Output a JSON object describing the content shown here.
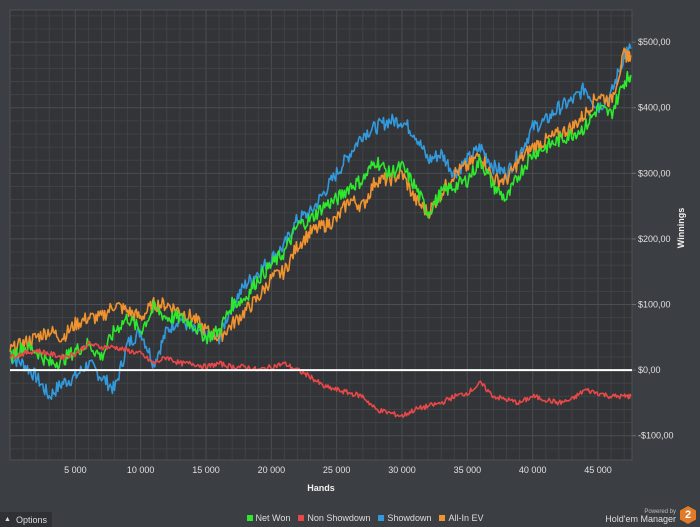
{
  "chart_data": {
    "type": "line",
    "title": "",
    "xlabel": "Hands",
    "ylabel": "Winnings",
    "xlim": [
      0,
      47600
    ],
    "ylim": [
      -137,
      549
    ],
    "xticks": [
      5000,
      10000,
      15000,
      20000,
      25000,
      30000,
      35000,
      40000,
      45000
    ],
    "xtick_labels": [
      "5 000",
      "10 000",
      "15 000",
      "20 000",
      "25 000",
      "30 000",
      "35 000",
      "40 000",
      "45 000"
    ],
    "yticks": [
      -100,
      0,
      100,
      200,
      300,
      400,
      500
    ],
    "ytick_labels": [
      "-$100,00",
      "$0,00",
      "$100,00",
      "$200,00",
      "$300,00",
      "$400,00",
      "$500,00"
    ],
    "grid": true,
    "legend_position": "bottom-center",
    "x": [
      0,
      1000,
      2000,
      3000,
      4000,
      5000,
      6000,
      7000,
      8000,
      9000,
      10000,
      11000,
      12000,
      13000,
      14000,
      15000,
      16000,
      17000,
      18000,
      19000,
      20000,
      21000,
      22000,
      23000,
      24000,
      25000,
      26000,
      27000,
      28000,
      29000,
      30000,
      31000,
      32000,
      33000,
      34000,
      35000,
      36000,
      37000,
      38000,
      39000,
      40000,
      41000,
      42000,
      43000,
      44000,
      45000,
      46000,
      47000,
      47500
    ],
    "series": [
      {
        "name": "Net Won",
        "color": "#2ee82e",
        "values": [
          20,
          35,
          30,
          10,
          15,
          30,
          40,
          20,
          60,
          80,
          60,
          95,
          80,
          80,
          70,
          50,
          60,
          100,
          110,
          140,
          160,
          180,
          220,
          230,
          250,
          260,
          280,
          290,
          320,
          300,
          310,
          280,
          240,
          270,
          280,
          290,
          320,
          280,
          260,
          300,
          330,
          340,
          350,
          360,
          370,
          400,
          390,
          440,
          450
        ]
      },
      {
        "name": "Non Showdown",
        "color": "#e84848",
        "values": [
          20,
          25,
          30,
          25,
          20,
          25,
          40,
          35,
          35,
          30,
          25,
          10,
          20,
          10,
          10,
          5,
          10,
          5,
          5,
          0,
          5,
          10,
          0,
          -10,
          -25,
          -30,
          -35,
          -40,
          -60,
          -65,
          -70,
          -60,
          -55,
          -50,
          -40,
          -35,
          -20,
          -40,
          -45,
          -50,
          -40,
          -45,
          -50,
          -45,
          -30,
          -35,
          -40,
          -40,
          -40
        ]
      },
      {
        "name": "Showdown",
        "color": "#3399dd",
        "values": [
          20,
          10,
          -10,
          -40,
          -20,
          -10,
          10,
          -10,
          -30,
          40,
          60,
          10,
          60,
          80,
          60,
          50,
          50,
          100,
          130,
          150,
          170,
          190,
          230,
          240,
          270,
          300,
          330,
          360,
          370,
          380,
          380,
          360,
          320,
          330,
          300,
          320,
          340,
          310,
          300,
          330,
          370,
          380,
          400,
          410,
          430,
          400,
          420,
          480,
          490
        ]
      },
      {
        "name": "All-In EV",
        "color": "#f0922e",
        "values": [
          30,
          40,
          50,
          60,
          50,
          70,
          80,
          80,
          100,
          90,
          80,
          100,
          100,
          90,
          80,
          60,
          50,
          70,
          90,
          110,
          140,
          150,
          190,
          210,
          220,
          230,
          260,
          250,
          290,
          290,
          300,
          260,
          240,
          270,
          300,
          310,
          330,
          290,
          290,
          320,
          340,
          350,
          360,
          370,
          390,
          420,
          410,
          480,
          480
        ]
      }
    ]
  },
  "options_label": "Options",
  "brand": {
    "powered_by": "Powered by",
    "name": "Hold'em Manager",
    "logo_text": "2"
  }
}
